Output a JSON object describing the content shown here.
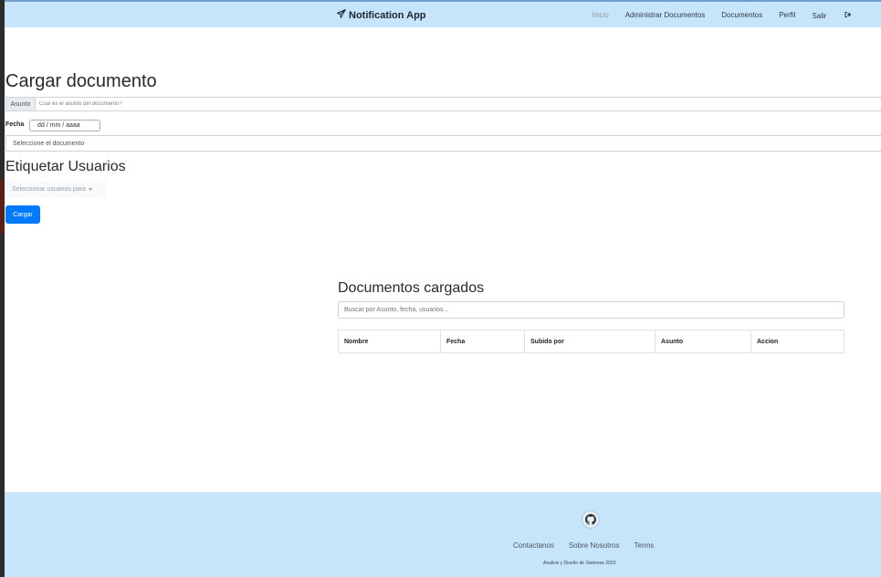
{
  "navbar": {
    "brand": "Notification App",
    "links": {
      "inicio": "Inicio",
      "administrar": "Administrar Documentos",
      "documentos": "Documentos",
      "perfil": "Perfil",
      "salir": "Salir"
    }
  },
  "upload": {
    "title": "Cargar documento",
    "asunto_label": "Asunto",
    "asunto_placeholder": "Cual es el asunto del documento?",
    "fecha_label": "Fecha",
    "fecha_value": "dd / mm / aaaa",
    "file_text": "Seleccione el documento"
  },
  "tag_users": {
    "title": "Etiquetar Usuarios",
    "select_text": "Seleccionar usuarios para"
  },
  "submit_label": "Cargar",
  "documents": {
    "title": "Documentos cargados",
    "search_placeholder": "Buscar por Asunto, fecha, usuarios...",
    "columns": [
      "Nombre",
      "Fecha",
      "Subido por",
      "Asunto",
      "Accion"
    ]
  },
  "footer": {
    "links": {
      "contact": "Contactanos",
      "about": "Sobre Nosotros",
      "terms": "Terms"
    },
    "copyright": "Analisis y Diseño de Sistemas 2020"
  },
  "icons": {
    "brand": "paper-plane-icon",
    "salir": "sign-out-icon",
    "footer": "github-icon"
  },
  "colors": {
    "navbar_bg": "#c6e5fb",
    "primary": "#007bff",
    "footer_bg": "#c6e5fb"
  }
}
